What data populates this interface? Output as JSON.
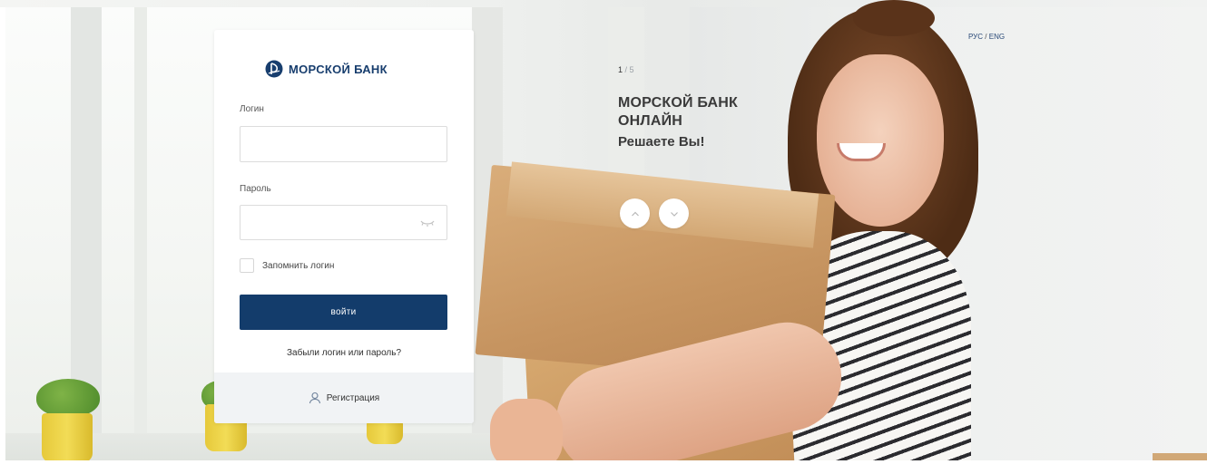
{
  "brand": {
    "name": "МОРСКОЙ БАНК",
    "color": "#183e6e"
  },
  "login_form": {
    "login_label": "Логин",
    "login_value": "",
    "password_label": "Пароль",
    "password_value": "",
    "remember_label": "Запомнить логин",
    "remember_checked": false,
    "submit_label": "войти",
    "forgot_label": "Забыли логин или пароль?",
    "register_label": "Регистрация",
    "accent_color": "#133c6b"
  },
  "hero": {
    "counter_current": "1",
    "counter_total": "/ 5",
    "title": "МОРСКОЙ БАНК ОНЛАЙН",
    "subtitle": "Решаете Вы!"
  },
  "language": {
    "ru": "РУС",
    "separator": "/",
    "en": "ENG"
  },
  "icons": {
    "logo": "bank-logo-icon",
    "password_toggle": "eye-closed-icon",
    "register": "user-icon",
    "prev_slide": "chevron-up-icon",
    "next_slide": "chevron-down-icon"
  }
}
